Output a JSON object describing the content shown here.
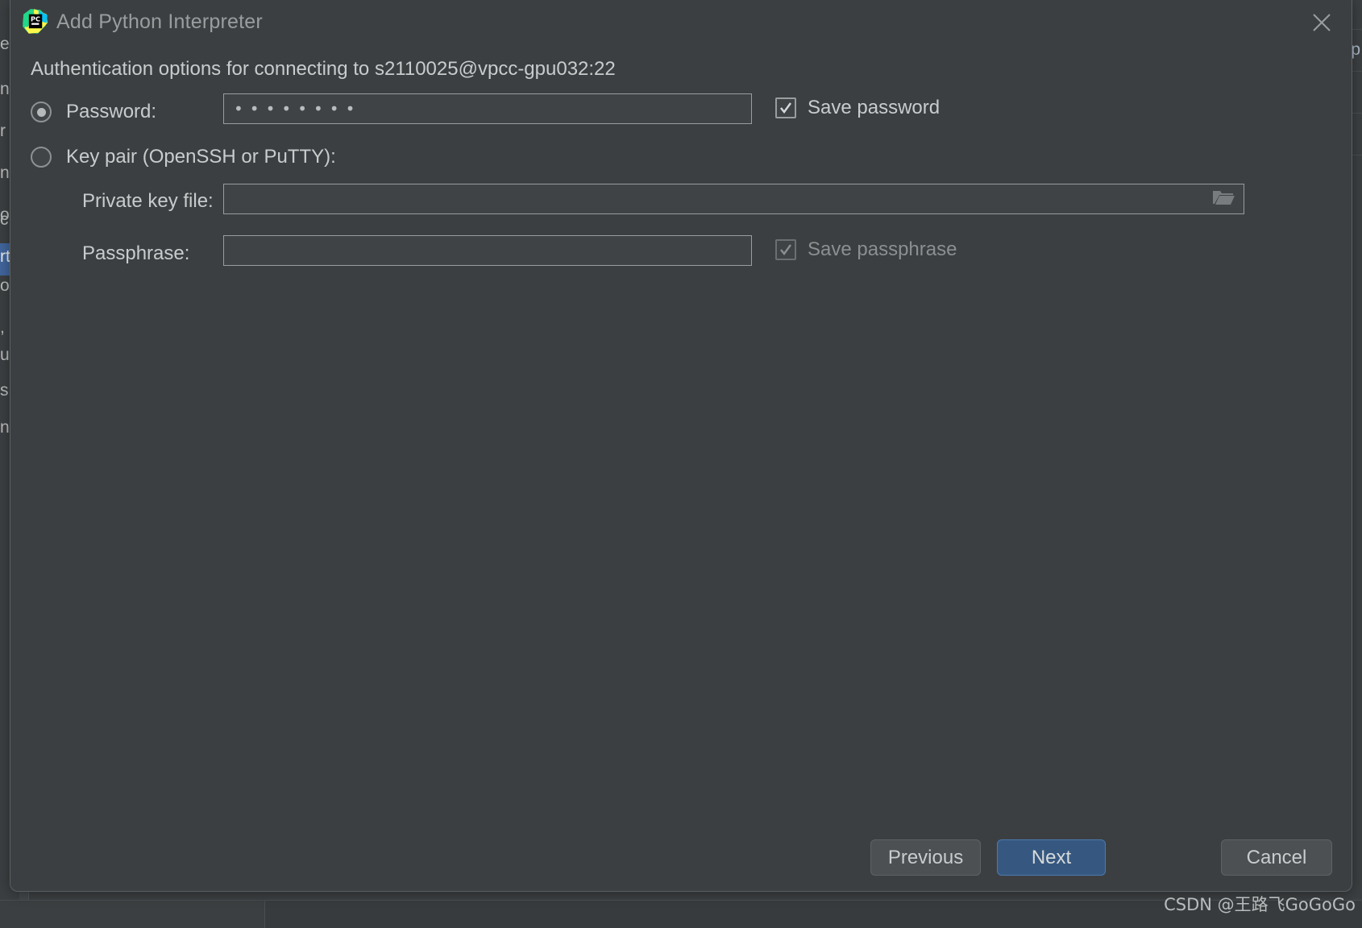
{
  "dialog": {
    "title": "Add Python Interpreter",
    "app_icon": "pycharm-icon",
    "close_icon": "close-icon",
    "subtitle": "Authentication options for connecting to s2110025@vpcc-gpu032:22"
  },
  "auth": {
    "password_option": {
      "label": "Password:",
      "selected": true,
      "value": "••••••••",
      "save_checkbox": {
        "label": "Save password",
        "checked": true,
        "enabled": true
      }
    },
    "keypair_option": {
      "label": "Key pair (OpenSSH or PuTTY):",
      "selected": false,
      "private_key": {
        "label": "Private key file:",
        "value": "",
        "placeholder": "",
        "browse_icon": "folder-icon"
      },
      "passphrase": {
        "label": "Passphrase:",
        "value": "",
        "placeholder": ""
      },
      "save_checkbox": {
        "label": "Save passphrase",
        "checked": true,
        "enabled": false
      }
    }
  },
  "footer": {
    "previous_label": "Previous",
    "next_label": "Next",
    "cancel_label": "Cancel"
  },
  "watermark": {
    "text": "CSDN @王路飞GoGoGo"
  },
  "colors": {
    "dialog_background": "#3c3f41",
    "primary_button": "#365880",
    "field_border": "#9a9d9e",
    "text": "#c8cccd",
    "title_text": "#9a9d9e",
    "selection": "#41659c"
  },
  "background_window": {
    "left_fragments": [
      "ea",
      "na",
      "r",
      "n",
      "o",
      "c",
      "rt",
      "o",
      ",",
      "u",
      "s",
      "n"
    ],
    "right_fragment": "/p"
  }
}
